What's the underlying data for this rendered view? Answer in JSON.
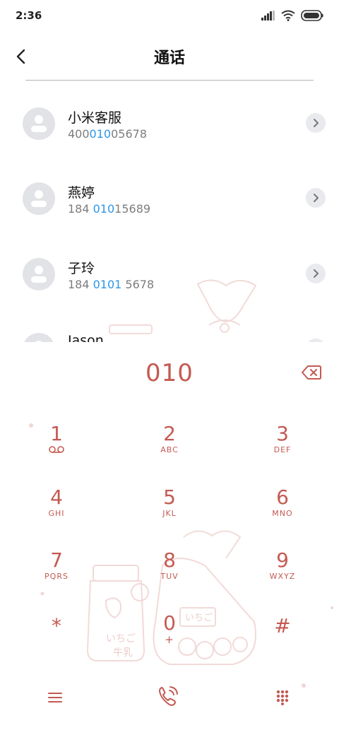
{
  "status_bar": {
    "time": "2:36"
  },
  "header": {
    "title": "通话"
  },
  "contacts": [
    {
      "name": "小米客服",
      "number_pre": "400",
      "number_hl": "010",
      "number_post": "05678"
    },
    {
      "name": "燕婷",
      "number_pre": "184 ",
      "number_hl": "010",
      "number_post": "15689"
    },
    {
      "name": "子玲",
      "number_pre": "184 ",
      "number_hl": "0101",
      "number_post": " 5678"
    },
    {
      "name": "Jason",
      "number_pre": "",
      "number_hl": "",
      "number_post": ""
    }
  ],
  "dialer": {
    "input": "010",
    "keys": [
      {
        "digit": "1",
        "letters": ""
      },
      {
        "digit": "2",
        "letters": "ABC"
      },
      {
        "digit": "3",
        "letters": "DEF"
      },
      {
        "digit": "4",
        "letters": "GHI"
      },
      {
        "digit": "5",
        "letters": "JKL"
      },
      {
        "digit": "6",
        "letters": "MNO"
      },
      {
        "digit": "7",
        "letters": "PQRS"
      },
      {
        "digit": "8",
        "letters": "TUV"
      },
      {
        "digit": "9",
        "letters": "WXYZ"
      },
      {
        "digit": "*",
        "letters": ""
      },
      {
        "digit": "0",
        "letters": "+"
      },
      {
        "digit": "#",
        "letters": ""
      }
    ]
  },
  "decor": {
    "label_1": "いちご",
    "label_2": "牛乳",
    "label_3": "いちご"
  },
  "colors": {
    "accent": "#c45a52",
    "highlight": "#2c97e6",
    "avatar_bg": "#e2e3e7"
  },
  "icons": {
    "back": "chevron-left-icon",
    "contact": "person-icon",
    "details": "chevron-right-icon",
    "backspace": "backspace-icon",
    "voicemail": "voicemail-icon",
    "menu": "menu-icon",
    "call": "phone-call-icon",
    "keypad": "keypad-icon"
  }
}
